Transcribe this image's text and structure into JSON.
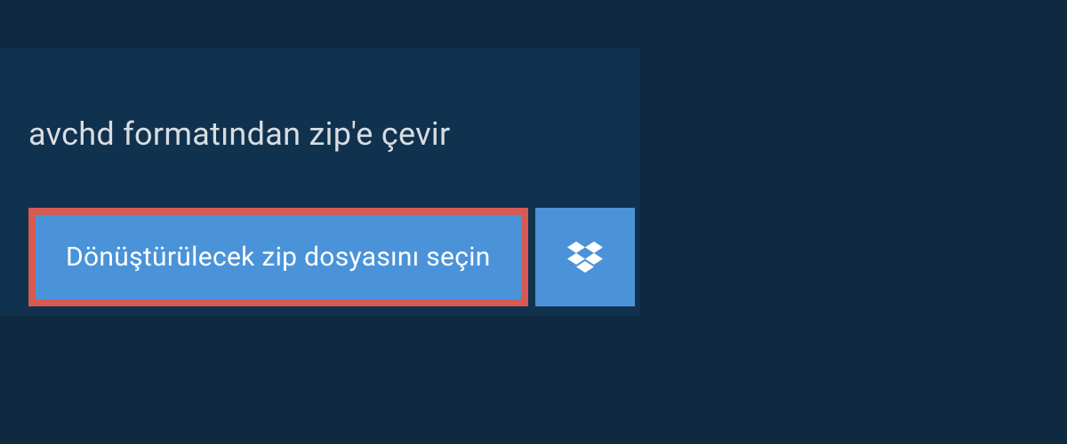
{
  "heading": "avchd formatından zip'e çevir",
  "select_button_label": "Dönüştürülecek zip dosyasını seçin"
}
